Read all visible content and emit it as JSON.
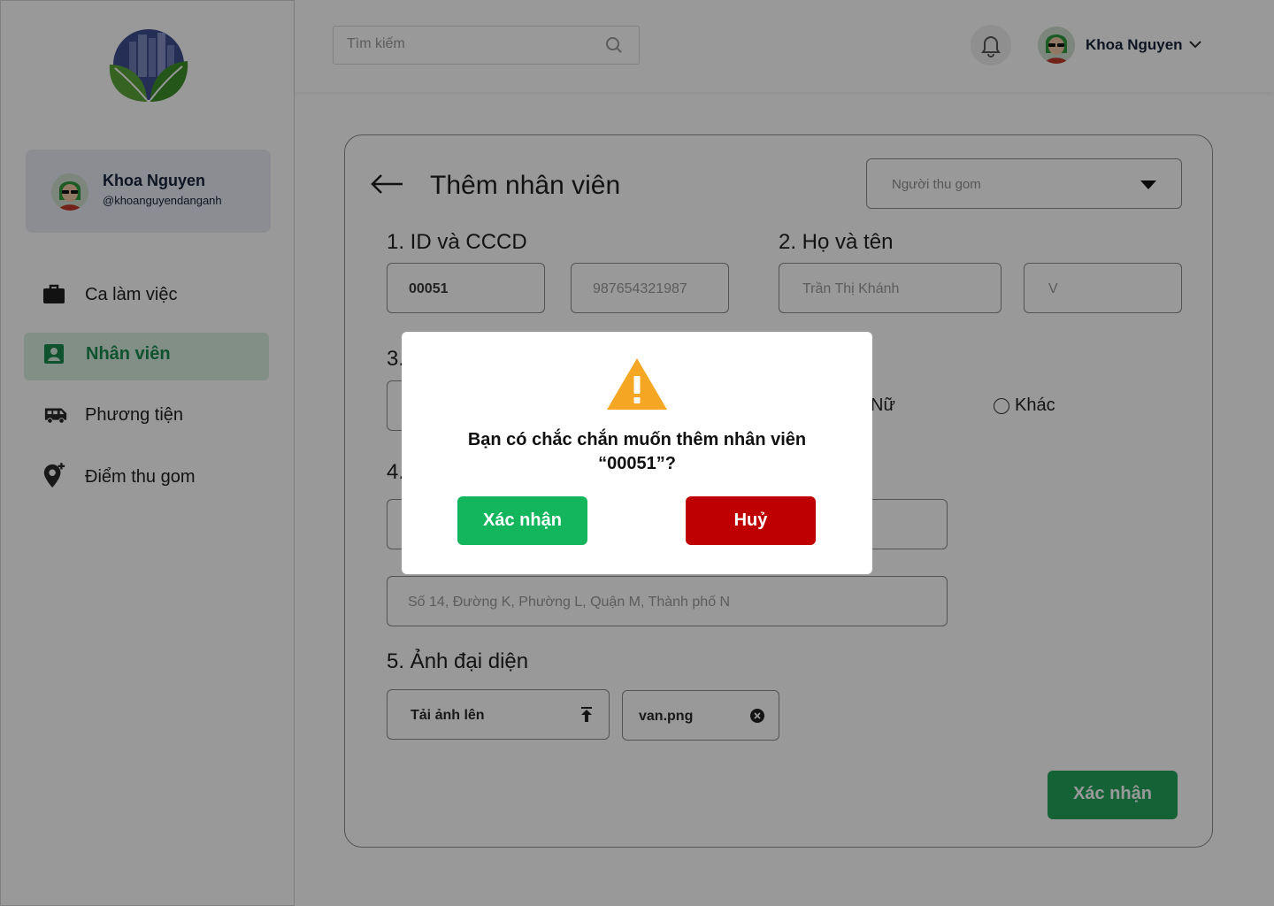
{
  "header": {
    "search_placeholder": "Tìm kiếm",
    "user_name": "Khoa Nguyen"
  },
  "sidebar": {
    "profile": {
      "name": "Khoa Nguyen",
      "handle": "@khoanguyendanganh"
    },
    "items": [
      {
        "label": "Ca làm việc",
        "icon": "briefcase-icon",
        "active": false
      },
      {
        "label": "Nhân viên",
        "icon": "id-card-icon",
        "active": true
      },
      {
        "label": "Phương tiện",
        "icon": "bus-icon",
        "active": false
      },
      {
        "label": "Điểm thu gom",
        "icon": "location-add-icon",
        "active": false
      }
    ]
  },
  "form": {
    "title": "Thêm nhân viên",
    "role_select": "Người thu gom",
    "sections": {
      "id": "1. ID và CCCD",
      "name": "2. Họ và tên",
      "s3_prefix": "3.",
      "s4_prefix": "4.",
      "avatar": "5. Ảnh đại diện"
    },
    "fields": {
      "id": "00051",
      "cccd": "987654321987",
      "last_name": "Trần Thị Khánh",
      "first_name": "V",
      "address": "Số 14, Đường K, Phường L, Quận M, Thành phố N"
    },
    "gender": {
      "female": "Nữ",
      "other": "Khác"
    },
    "upload_label": "Tải ảnh lên",
    "uploaded_file": "van.png",
    "submit_label": "Xác nhận"
  },
  "modal": {
    "line1": "Bạn có chắc chắn muốn thêm nhân viên",
    "line2": "“00051”?",
    "confirm_label": "Xác nhận",
    "cancel_label": "Huỷ"
  },
  "colors": {
    "primary_green": "#22a35a",
    "confirm_green": "#13b65c",
    "cancel_red": "#bf0000",
    "warning_orange": "#f5a623",
    "active_nav_bg": "#d7efe0"
  }
}
